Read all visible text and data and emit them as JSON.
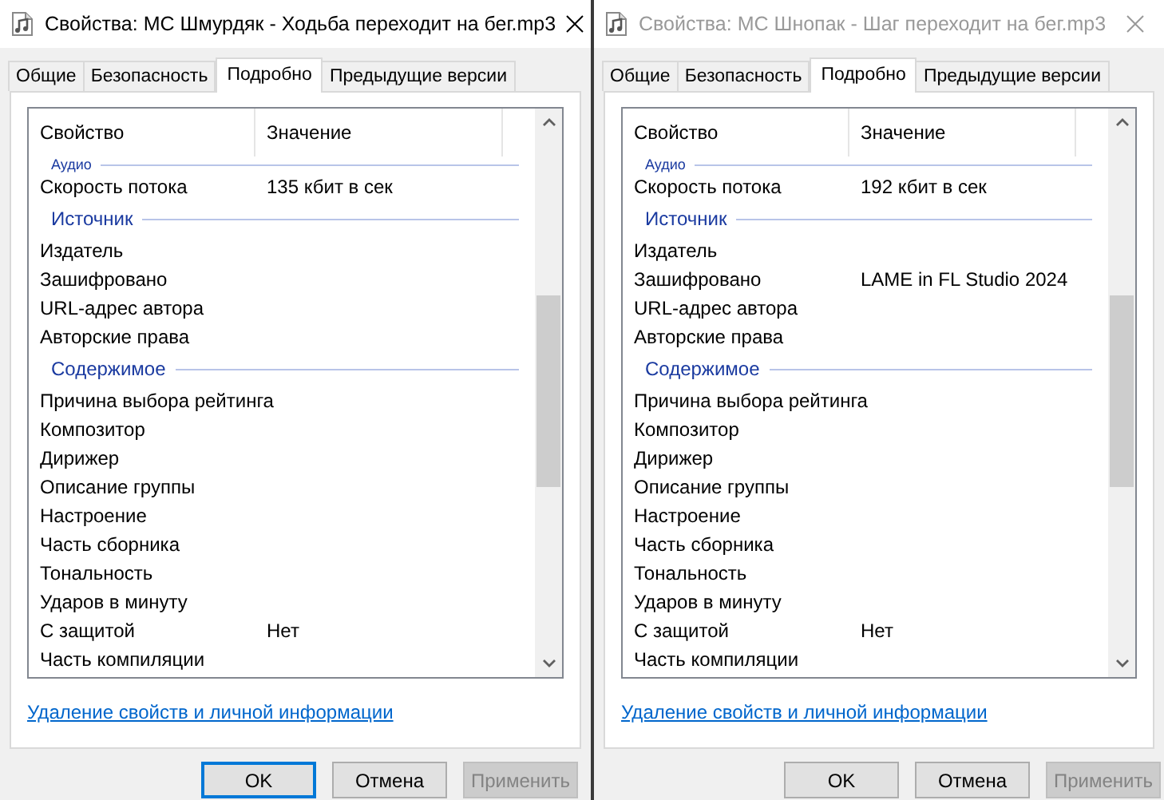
{
  "windows": [
    {
      "title": "Свойства: МС Шмурдяк - Ходьба переходит на бег.mp3",
      "active": true,
      "tabs": [
        {
          "label": "Общие",
          "selected": false
        },
        {
          "label": "Безопасность",
          "selected": false
        },
        {
          "label": "Подробно",
          "selected": true
        },
        {
          "label": "Предыдущие версии",
          "selected": false
        }
      ],
      "columns": [
        "Свойство",
        "Значение"
      ],
      "rows": [
        {
          "kind": "group",
          "name": "Аудио"
        },
        {
          "kind": "prop",
          "name": "Скорость потока",
          "value": "135 кбит в сек"
        },
        {
          "kind": "group",
          "name": "Источник"
        },
        {
          "kind": "prop",
          "name": "Издатель"
        },
        {
          "kind": "prop",
          "name": "Зашифровано"
        },
        {
          "kind": "prop",
          "name": "URL-адрес автора"
        },
        {
          "kind": "prop",
          "name": "Авторские права"
        },
        {
          "kind": "group",
          "name": "Содержимое"
        },
        {
          "kind": "prop",
          "name": "Причина выбора рейтинга"
        },
        {
          "kind": "prop",
          "name": "Композитор"
        },
        {
          "kind": "prop",
          "name": "Дирижер"
        },
        {
          "kind": "prop",
          "name": "Описание группы"
        },
        {
          "kind": "prop",
          "name": "Настроение"
        },
        {
          "kind": "prop",
          "name": "Часть сборника"
        },
        {
          "kind": "prop",
          "name": "Тональность"
        },
        {
          "kind": "prop",
          "name": "Ударов в минуту"
        },
        {
          "kind": "prop",
          "name": "С защитой",
          "value": "Нет"
        },
        {
          "kind": "prop",
          "name": "Часть компиляции"
        }
      ],
      "link": "Удаление свойств и личной информации",
      "buttons": [
        {
          "label": "OK",
          "kind": "default"
        },
        {
          "label": "Отмена",
          "kind": "normal"
        },
        {
          "label": "Применить",
          "kind": "disabled"
        }
      ]
    },
    {
      "title": "Свойства: МС Шнопак - Шаг переходит на бег.mp3",
      "active": false,
      "tabs": [
        {
          "label": "Общие",
          "selected": false
        },
        {
          "label": "Безопасность",
          "selected": false
        },
        {
          "label": "Подробно",
          "selected": true
        },
        {
          "label": "Предыдущие версии",
          "selected": false
        }
      ],
      "columns": [
        "Свойство",
        "Значение"
      ],
      "rows": [
        {
          "kind": "group",
          "name": "Аудио"
        },
        {
          "kind": "prop",
          "name": "Скорость потока",
          "value": "192 кбит в сек"
        },
        {
          "kind": "group",
          "name": "Источник"
        },
        {
          "kind": "prop",
          "name": "Издатель"
        },
        {
          "kind": "prop",
          "name": "Зашифровано",
          "value": "LAME in FL Studio 2024"
        },
        {
          "kind": "prop",
          "name": "URL-адрес автора"
        },
        {
          "kind": "prop",
          "name": "Авторские права"
        },
        {
          "kind": "group",
          "name": "Содержимое"
        },
        {
          "kind": "prop",
          "name": "Причина выбора рейтинга"
        },
        {
          "kind": "prop",
          "name": "Композитор"
        },
        {
          "kind": "prop",
          "name": "Дирижер"
        },
        {
          "kind": "prop",
          "name": "Описание группы"
        },
        {
          "kind": "prop",
          "name": "Настроение"
        },
        {
          "kind": "prop",
          "name": "Часть сборника"
        },
        {
          "kind": "prop",
          "name": "Тональность"
        },
        {
          "kind": "prop",
          "name": "Ударов в минуту"
        },
        {
          "kind": "prop",
          "name": "С защитой",
          "value": "Нет"
        },
        {
          "kind": "prop",
          "name": "Часть компиляции"
        }
      ],
      "link": "Удаление свойств и личной информации",
      "buttons": [
        {
          "label": "OK",
          "kind": "normal"
        },
        {
          "label": "Отмена",
          "kind": "normal"
        },
        {
          "label": "Применить",
          "kind": "disabled"
        }
      ]
    }
  ]
}
